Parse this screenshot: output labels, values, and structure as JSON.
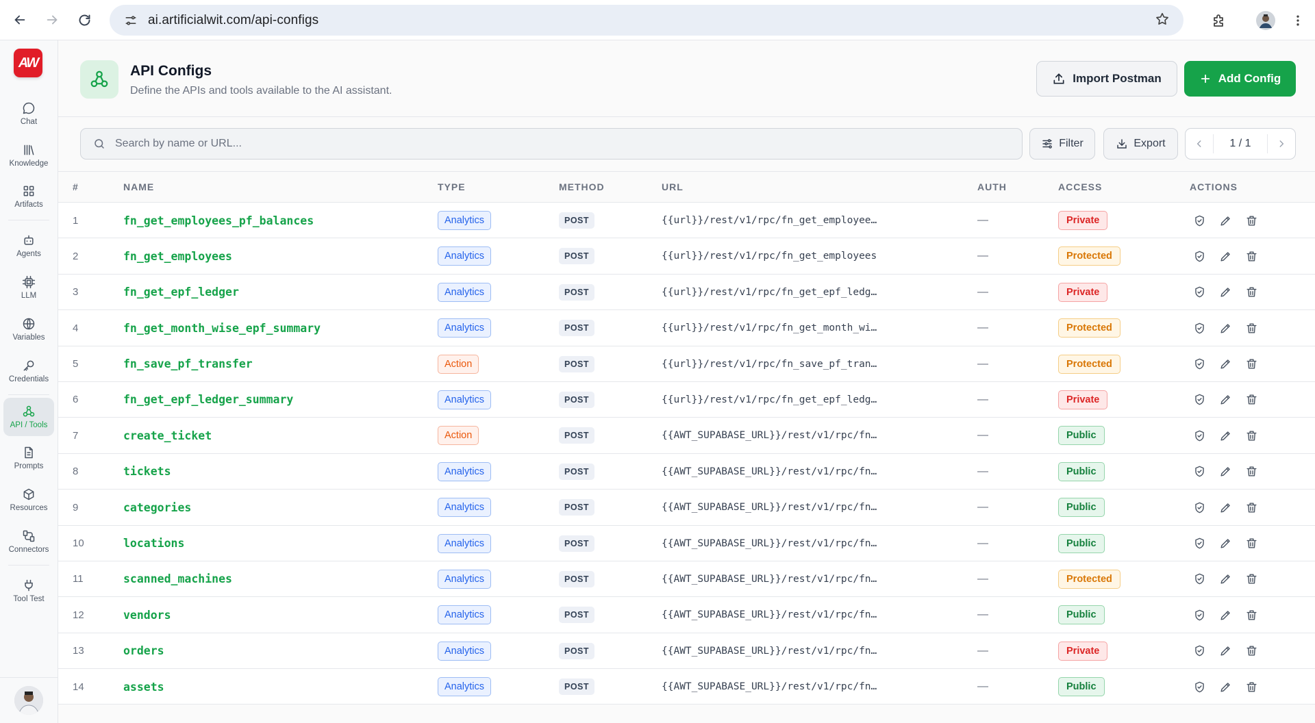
{
  "browser": {
    "url": "ai.artificialwit.com/api-configs"
  },
  "sidebar": {
    "logo_text": "AW",
    "items": [
      {
        "label": "Chat"
      },
      {
        "label": "Knowledge"
      },
      {
        "label": "Artifacts"
      },
      {
        "label": "Agents"
      },
      {
        "label": "LLM"
      },
      {
        "label": "Variables"
      },
      {
        "label": "Credentials"
      },
      {
        "label": "API / Tools"
      },
      {
        "label": "Prompts"
      },
      {
        "label": "Resources"
      },
      {
        "label": "Connectors"
      },
      {
        "label": "Tool Test"
      }
    ],
    "active_index": 7
  },
  "header": {
    "title": "API Configs",
    "subtitle": "Define the APIs and tools available to the AI assistant.",
    "import_label": "Import Postman",
    "add_label": "Add Config"
  },
  "toolbar": {
    "search_placeholder": "Search by name or URL...",
    "filter_label": "Filter",
    "export_label": "Export",
    "page_text": "1 / 1"
  },
  "table": {
    "columns": {
      "num": "#",
      "name": "NAME",
      "type": "TYPE",
      "method": "METHOD",
      "url": "URL",
      "auth": "AUTH",
      "access": "ACCESS",
      "actions": "ACTIONS"
    },
    "rows": [
      {
        "num": "1",
        "name": "fn_get_employees_pf_balances",
        "type": "Analytics",
        "method": "POST",
        "url": "{{url}}/rest/v1/rpc/fn_get_employee…",
        "auth": "—",
        "access": "Private"
      },
      {
        "num": "2",
        "name": "fn_get_employees",
        "type": "Analytics",
        "method": "POST",
        "url": "{{url}}/rest/v1/rpc/fn_get_employees",
        "auth": "—",
        "access": "Protected"
      },
      {
        "num": "3",
        "name": "fn_get_epf_ledger",
        "type": "Analytics",
        "method": "POST",
        "url": "{{url}}/rest/v1/rpc/fn_get_epf_ledg…",
        "auth": "—",
        "access": "Private"
      },
      {
        "num": "4",
        "name": "fn_get_month_wise_epf_summary",
        "type": "Analytics",
        "method": "POST",
        "url": "{{url}}/rest/v1/rpc/fn_get_month_wi…",
        "auth": "—",
        "access": "Protected"
      },
      {
        "num": "5",
        "name": "fn_save_pf_transfer",
        "type": "Action",
        "method": "POST",
        "url": "{{url}}/rest/v1/rpc/fn_save_pf_tran…",
        "auth": "—",
        "access": "Protected"
      },
      {
        "num": "6",
        "name": "fn_get_epf_ledger_summary",
        "type": "Analytics",
        "method": "POST",
        "url": "{{url}}/rest/v1/rpc/fn_get_epf_ledg…",
        "auth": "—",
        "access": "Private"
      },
      {
        "num": "7",
        "name": "create_ticket",
        "type": "Action",
        "method": "POST",
        "url": "{{AWT_SUPABASE_URL}}/rest/v1/rpc/fn…",
        "auth": "—",
        "access": "Public"
      },
      {
        "num": "8",
        "name": "tickets",
        "type": "Analytics",
        "method": "POST",
        "url": "{{AWT_SUPABASE_URL}}/rest/v1/rpc/fn…",
        "auth": "—",
        "access": "Public"
      },
      {
        "num": "9",
        "name": "categories",
        "type": "Analytics",
        "method": "POST",
        "url": "{{AWT_SUPABASE_URL}}/rest/v1/rpc/fn…",
        "auth": "—",
        "access": "Public"
      },
      {
        "num": "10",
        "name": "locations",
        "type": "Analytics",
        "method": "POST",
        "url": "{{AWT_SUPABASE_URL}}/rest/v1/rpc/fn…",
        "auth": "—",
        "access": "Public"
      },
      {
        "num": "11",
        "name": "scanned_machines",
        "type": "Analytics",
        "method": "POST",
        "url": "{{AWT_SUPABASE_URL}}/rest/v1/rpc/fn…",
        "auth": "—",
        "access": "Protected"
      },
      {
        "num": "12",
        "name": "vendors",
        "type": "Analytics",
        "method": "POST",
        "url": "{{AWT_SUPABASE_URL}}/rest/v1/rpc/fn…",
        "auth": "—",
        "access": "Public"
      },
      {
        "num": "13",
        "name": "orders",
        "type": "Analytics",
        "method": "POST",
        "url": "{{AWT_SUPABASE_URL}}/rest/v1/rpc/fn…",
        "auth": "—",
        "access": "Private"
      },
      {
        "num": "14",
        "name": "assets",
        "type": "Analytics",
        "method": "POST",
        "url": "{{AWT_SUPABASE_URL}}/rest/v1/rpc/fn…",
        "auth": "—",
        "access": "Public"
      }
    ]
  },
  "colors": {
    "accent": "#16a34a",
    "logo": "#e11d28",
    "private": "#dc2626",
    "protected": "#d97706",
    "public": "#15803d",
    "analytics": "#2563eb",
    "action": "#ea580c"
  }
}
